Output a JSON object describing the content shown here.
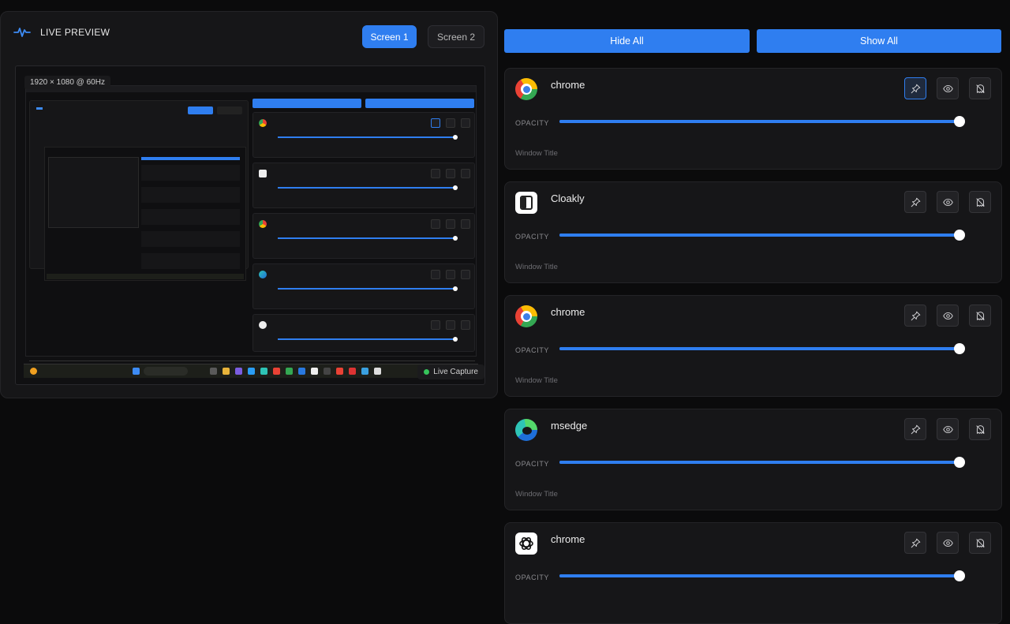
{
  "preview": {
    "title": "LIVE PREVIEW",
    "screens": [
      "Screen 1",
      "Screen 2"
    ],
    "active_screen": "Screen 1",
    "resolution": "1920 × 1080 @ 60Hz",
    "live_label": "Live Capture"
  },
  "controls": {
    "hide_all": "Hide All",
    "show_all": "Show All"
  },
  "windows": [
    {
      "name": "chrome",
      "icon": "chrome-icon",
      "opacity_label": "OPACITY",
      "opacity": 1.0,
      "title_placeholder": "Window Title",
      "pinned": true
    },
    {
      "name": "Cloakly",
      "icon": "cloakly-icon",
      "opacity_label": "OPACITY",
      "opacity": 1.0,
      "title_placeholder": "Window Title",
      "pinned": false
    },
    {
      "name": "chrome",
      "icon": "chrome-icon",
      "opacity_label": "OPACITY",
      "opacity": 1.0,
      "title_placeholder": "Window Title",
      "pinned": false
    },
    {
      "name": "msedge",
      "icon": "msedge-icon",
      "opacity_label": "OPACITY",
      "opacity": 1.0,
      "title_placeholder": "Window Title",
      "pinned": false
    },
    {
      "name": "chrome",
      "icon": "chatgpt-icon",
      "opacity_label": "OPACITY",
      "opacity": 1.0,
      "title_placeholder": "",
      "pinned": false
    }
  ],
  "colors": {
    "accent": "#2f7ef0",
    "background": "#0b0b0c",
    "card": "#161618",
    "live": "#36c45b"
  }
}
